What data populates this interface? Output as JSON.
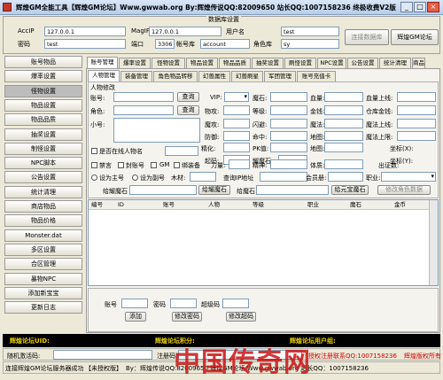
{
  "window": {
    "title": "辉煌GM全能工具【辉煌GM论坛】Www.gwwab.org By:辉煌传说QQ:82009650 站长QQ:1007158236 终极收费V2版",
    "buttons": [
      "_",
      "□",
      "×"
    ]
  },
  "db": {
    "group_label": "数据库设置",
    "acc_ip_label": "AccIP",
    "acc_ip_value": "127.0.0.1",
    "mag_ip_label": "MagIP",
    "mag_ip_value": "127.0.0.1",
    "user_label": "用户名",
    "user_value": "test",
    "password_label": "密码",
    "password_value": "test",
    "port_label": "端口",
    "port_value": "3306",
    "account_table_label": "帐号库",
    "account_table_value": "account",
    "role_table_label": "角色库",
    "role_table_value": "sy",
    "connect_button": "连接数据库",
    "forum_button": "辉煌GM论坛"
  },
  "sidebar": {
    "items": [
      "账号物品",
      "爆率设置",
      "怪物设置",
      "物品设置",
      "物品品质",
      "抽奖设置",
      "制怪设置",
      "NPC脚本",
      "公告设置",
      "统计清理",
      "商店物品",
      "物品价格",
      "Monster.dat",
      "多区设置",
      "合区管理",
      "暴物NPC",
      "添加新宝宝",
      "更新日志"
    ],
    "active_index": 2
  },
  "main_tabs": [
    "账号管理",
    "爆率设置",
    "怪物设置",
    "物品设置",
    "物品品质",
    "抽奖设置",
    "刷怪设置",
    "NPC设置",
    "公告设置",
    "统计清理",
    "商品"
  ],
  "sub_tabs": [
    "人物管理",
    "装备管理",
    "角色物品转移",
    "幻兽属性",
    "幻兽刷星",
    "军团管理",
    "账号充值卡"
  ],
  "form": {
    "section_title": "人物修改",
    "account_label": "账号:",
    "query_button": "查询",
    "vip_label": "VIP:",
    "role_label": "角色:",
    "query_button2": "查询",
    "nick_label": "小号:",
    "magic_stone_label": "魔石:",
    "money_label": "金钱:",
    "bind_money_label": "绑定金钱:",
    "attack_label": "物攻:",
    "level_label": "等级:",
    "warehouse_money_label": "仓库金钱:",
    "magic_atk_label": "魔攻:",
    "dodge_label": "闪避:",
    "life_label": "魔法上限:",
    "defense_label": "防御:",
    "hit_label": "命中:",
    "magic_limit_label": "魔法上限:",
    "crit_label": "精化:",
    "pk_label": "PK值:",
    "map_label": "地图:",
    "coord_x_label": "坐标(X):",
    "coord_y_label": "坐标(Y):",
    "hp_label": "血量:",
    "hp_max_label": "血量上线:",
    "mp_label": "魔法:",
    "mp_max_label": "魔法上线:",
    "map2_label": "地图:",
    "online_check": "是否在线人物名",
    "origin_label": "起码:",
    "fly_label": "耀魔石:",
    "coord_label": "坐标(Y):",
    "ban_check": "禁言",
    "seal_check": "封账号",
    "gm_check": "GM",
    "equip_check": "绑装备",
    "power_label": "力量:",
    "spirit_label": "精神:",
    "body_label": "体质:",
    "agility_label": "出证数:",
    "main_radio": "设为主号",
    "sub_radio": "设为副号",
    "wood_label": "木材:",
    "bind_ip_label": "查询IP地址",
    "member_label": "会员册:",
    "job_label": "职业:",
    "give_stone_label": "给耀魔石",
    "give_stone_btn": "给耀魔石",
    "give_ore_label": "给魔石",
    "give_ore_btn": "给元宝魔石",
    "modify_btn": "修改角色数据"
  },
  "table": {
    "headers": [
      "编号",
      "ID",
      "账号",
      "人物",
      "等级",
      "职业",
      "魔石",
      "金币"
    ]
  },
  "bottom_form": {
    "account_label": "账号",
    "password_label": "密码",
    "super_label": "超级码",
    "add_button": "添加",
    "change_pwd_button": "修改密码",
    "change_super_button": "修改超码"
  },
  "forum_bar": {
    "uid_label": "辉煌论坛UID:",
    "points_label": "辉煌论坛积分:",
    "group_label": "辉煌论坛用户组:"
  },
  "status": {
    "random_label": "随机激活码:",
    "register_label": "注册码:",
    "auth_text": "授权注册联系QQ:1007158236",
    "version_text": "辉煌版权所有",
    "connected_text": "连接辉煌GM论坛服务器成功",
    "edition_text": "【未授权版】",
    "author_text": "By：辉煌传说QQ:82009650 辉煌GM论坛 Www.gwwab.org 站长QQ：1007158236"
  },
  "watermark": "中国传奇网",
  "colors": {
    "window_bg": "#ece9d8",
    "forum_bar_bg": "#000000",
    "forum_bar_text": "#f0d000",
    "warning_text": "#cc0000"
  }
}
